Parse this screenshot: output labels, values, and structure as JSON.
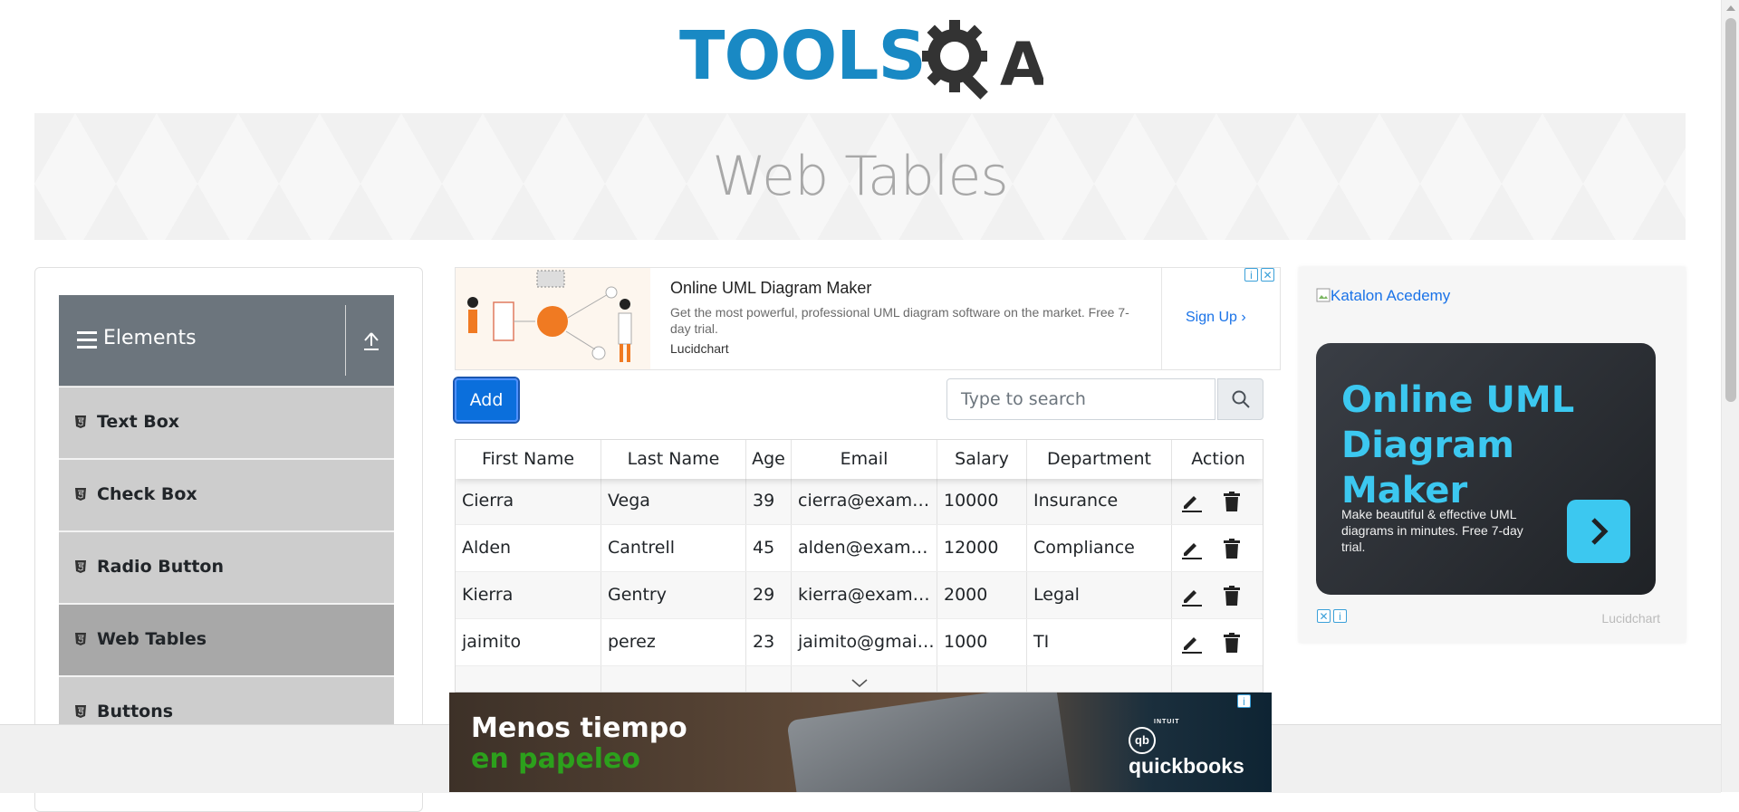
{
  "header": {
    "logo_text": "TOOLS",
    "logo_suffix": "A",
    "page_title": "Web Tables"
  },
  "sidebar": {
    "group_title": "Elements",
    "items": [
      {
        "label": "Text Box"
      },
      {
        "label": "Check Box"
      },
      {
        "label": "Radio Button"
      },
      {
        "label": "Web Tables",
        "active": true
      },
      {
        "label": "Buttons"
      }
    ]
  },
  "top_ad": {
    "title": "Online UML Diagram Maker",
    "description": "Get the most powerful, professional UML diagram software on the market. Free 7-day trial.",
    "brand": "Lucidchart",
    "cta": "Sign Up"
  },
  "toolbar": {
    "add_label": "Add",
    "search_placeholder": "Type to search"
  },
  "table": {
    "columns": [
      "First Name",
      "Last Name",
      "Age",
      "Email",
      "Salary",
      "Department",
      "Action"
    ],
    "rows": [
      {
        "first": "Cierra",
        "last": "Vega",
        "age": "39",
        "email": "cierra@exampl...",
        "salary": "10000",
        "department": "Insurance"
      },
      {
        "first": "Alden",
        "last": "Cantrell",
        "age": "45",
        "email": "alden@exampl...",
        "salary": "12000",
        "department": "Compliance"
      },
      {
        "first": "Kierra",
        "last": "Gentry",
        "age": "29",
        "email": "kierra@examp...",
        "salary": "2000",
        "department": "Legal"
      },
      {
        "first": "jaimito",
        "last": "perez",
        "age": "23",
        "email": "jaimito@gmail...",
        "salary": "1000",
        "department": "TI"
      }
    ]
  },
  "right_ad": {
    "broken_image_alt": "Katalon Acedemy",
    "title": "Online UML Diagram Maker",
    "subtitle": "Make beautiful & effective UML diagrams in minutes. Free 7-day trial.",
    "brand": "Lucidchart"
  },
  "bottom_ad": {
    "line1": "Menos tiempo",
    "line2": "en papeleo",
    "brand": "quickbooks",
    "brand_small": "INTUIT"
  },
  "colors": {
    "accent": "#0b6fdc",
    "logo_blue": "#1989c4",
    "nav_header": "#6c757d",
    "ad_cyan": "#3cc8f0"
  }
}
